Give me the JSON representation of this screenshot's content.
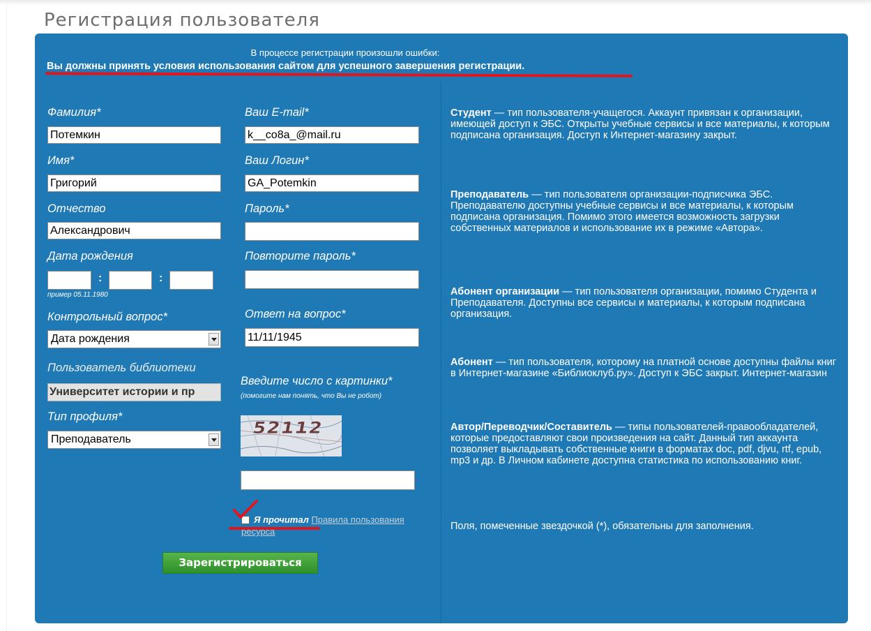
{
  "page_title": "Регистрация пользователя",
  "errors": {
    "heading": "В процессе регистрации произошли ошибки:",
    "message": "Вы должны принять условия использования сайтом для успешного завершения регистрации."
  },
  "form": {
    "surname": {
      "label": "Фамилия*",
      "value": "Потемкин"
    },
    "name": {
      "label": "Имя*",
      "value": "Григорий"
    },
    "patronymic": {
      "label": "Отчество",
      "value": "Александрович"
    },
    "birth_date": {
      "label": "Дата рождения",
      "separator": ":",
      "example": "пример 05.11.1980"
    },
    "security_question": {
      "label": "Контрольный вопрос*",
      "value": "Дата рождения"
    },
    "library_user": {
      "label": "Пользователь библиотеки",
      "value": "Университет истории и пр"
    },
    "profile_type": {
      "label": "Тип профиля*",
      "value": "Преподаватель"
    },
    "email": {
      "label": "Ваш E-mail*",
      "value": "k__co8a_@mail.ru"
    },
    "login": {
      "label": "Ваш Логин*",
      "value": "GA_Potemkin"
    },
    "password": {
      "label": "Пароль*",
      "value": ""
    },
    "password_repeat": {
      "label": "Повторите пароль*",
      "value": ""
    },
    "answer": {
      "label": "Ответ на вопрос*",
      "value": "11/11/1945"
    },
    "captcha": {
      "label": "Введите число с картинки*",
      "hint": "(помогите нам понять, что Вы не робот)",
      "image_text": "52112",
      "value": ""
    },
    "agree": {
      "text": "Я прочитал",
      "link_part1": "Правила пользования",
      "link_part2": "ресурса"
    },
    "submit_label": "Зарегистрироваться"
  },
  "info": {
    "student": {
      "term": "Студент",
      "text": " — тип пользователя-учащегося. Аккаунт привязан к организации, имеющей доступ к ЭБС. Открыты учебные сервисы и все материалы, к которым подписана организация. Доступ к Интернет-магазину закрыт."
    },
    "teacher": {
      "term": "Преподаватель",
      "text": " — тип пользователя организации-подписчика ЭБС. Преподавателю доступны учебные сервисы и все материалы, к которым подписана организация. Помимо этого имеется возможность загрузки собственных материалов и использование их в режиме «Автора»."
    },
    "org_subscriber": {
      "term": "Абонент организации",
      "text": " — тип пользователя организации, помимо Студента и Преподавателя. Доступны все сервисы и материалы, к которым подписана организация."
    },
    "subscriber": {
      "term": "Абонент",
      "text": " — тип пользователя, которому на платной основе доступны файлы книг в Интернет-магазине «Библиоклуб.ру». Доступ к ЭБС закрыт. Интернет-магазин"
    },
    "author": {
      "term": "Автор/Переводчик/Составитель",
      "text": " — типы пользователей-правообладателей, которые предоставляют свои произведения на сайт. Данный тип аккаунта позволяет выкладывать собственные книги в форматах doc, pdf, djvu, rtf, epub, mp3 и др. В Личном кабинете доступна статистика по использованию книг."
    },
    "required_note": "Поля, помеченные звездочкой (*), обязательны для заполнения."
  },
  "colors": {
    "panel": "#1f79b5",
    "button": "#3fa03a",
    "error_underline": "#e0161e"
  }
}
